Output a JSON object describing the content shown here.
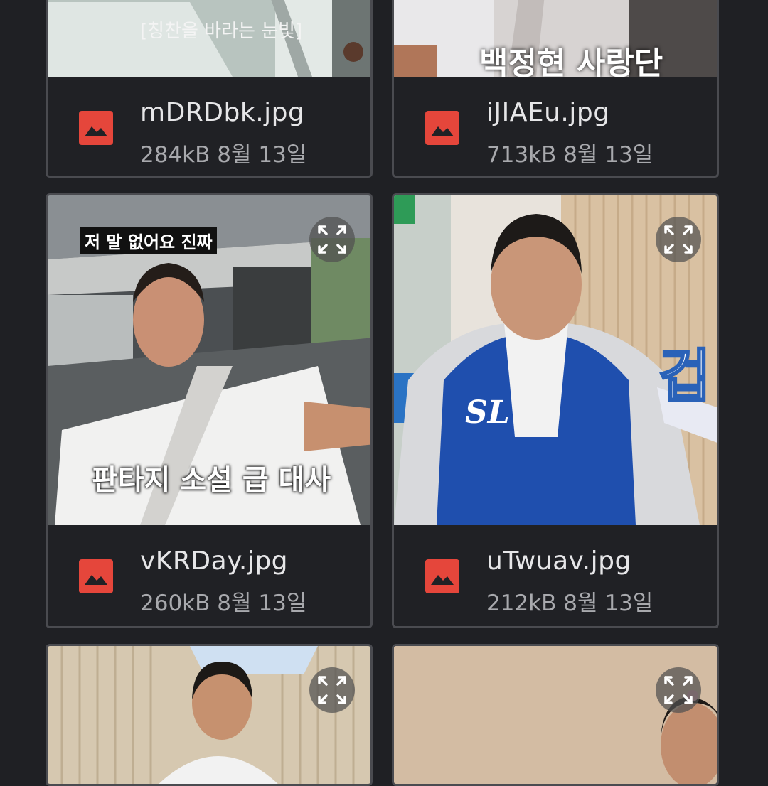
{
  "files": [
    {
      "name": "mDRDbk.jpg",
      "size": "284kB",
      "date": "8월 13일",
      "caption": "[칭찬을 바라는 눈빛]"
    },
    {
      "name": "iJIAEu.jpg",
      "size": "713kB",
      "date": "8월 13일",
      "caption": "백정현 사랑단"
    },
    {
      "name": "vKRDay.jpg",
      "size": "260kB",
      "date": "8월 13일",
      "caption_top": "저 말 없어요 진짜",
      "caption": "판타지 소설 급 대사"
    },
    {
      "name": "uTwuav.jpg",
      "size": "212kB",
      "date": "8월 13일",
      "caption": "겁"
    },
    {
      "name": "",
      "size": "",
      "date": ""
    },
    {
      "name": "",
      "size": "",
      "date": ""
    }
  ],
  "colors": {
    "background": "#1f2024",
    "card_border": "#4a4b50",
    "image_icon": "#e5463b"
  },
  "icons": {
    "file_type": "image-icon",
    "expand": "expand-icon"
  }
}
